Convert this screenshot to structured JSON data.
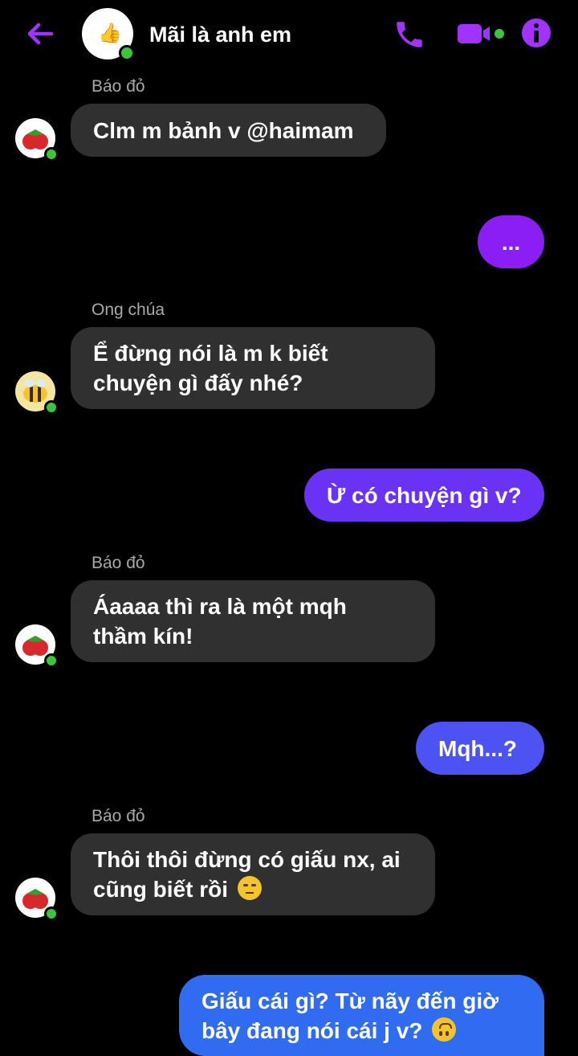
{
  "header": {
    "title": "Mãi là anh em",
    "accent_color": "#a033ff",
    "icons": [
      "back-arrow-icon",
      "phone-icon",
      "video-camera-icon",
      "info-icon"
    ]
  },
  "colors": {
    "bubble_incoming": "#303030",
    "bubble_outgoing_1": "#8a1ef5",
    "bubble_outgoing_2": "#6a32f5",
    "bubble_outgoing_3": "#4d52f2",
    "bubble_outgoing_4": "#2f6cf0",
    "online": "#3cc53c"
  },
  "messages": {
    "m1": {
      "sender": "Báo đỏ",
      "text": "Clm m bảnh v @haimam"
    },
    "m2": {
      "text": "..."
    },
    "m3": {
      "sender": "Ong chúa",
      "line1": "Ể đừng nói là m k biết",
      "line2": "chuyện gì đấy nhé?"
    },
    "m4": {
      "text": "Ừ có chuyện gì v?"
    },
    "m5": {
      "sender": "Báo đỏ",
      "line1": "Áaaaa thì ra là một mqh",
      "line2": "thầm kín!"
    },
    "m6": {
      "text": "Mqh...?"
    },
    "m7": {
      "sender": "Báo đỏ",
      "line1": "Thôi thôi đừng có giấu nx, ai",
      "line2": "cũng biết rồi",
      "emoji": "unamused-face-emoji"
    },
    "m8": {
      "line1": "Giấu cái gì? Từ nãy đến giờ",
      "line2": "bây đang nói cái j v?",
      "emoji": "upside-down-face-emoji"
    }
  }
}
